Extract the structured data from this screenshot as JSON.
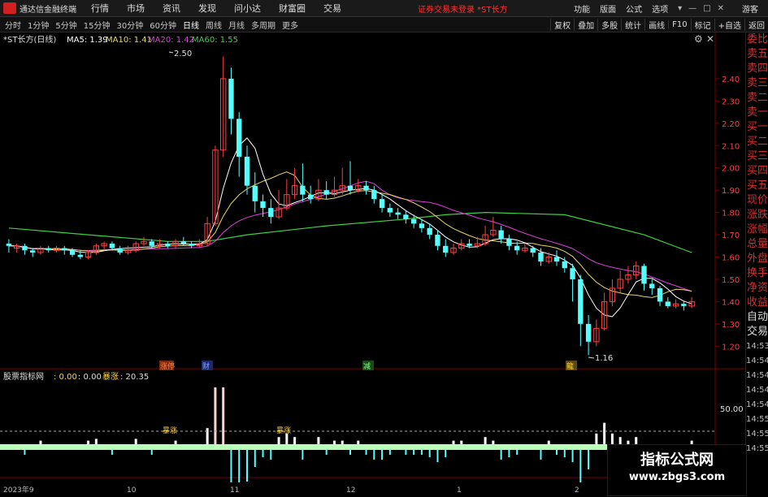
{
  "app": {
    "title": "通达信金融终端"
  },
  "menu": [
    "行情",
    "市场",
    "资讯",
    "发现",
    "问小达",
    "财富圈",
    "交易"
  ],
  "status": "证券交易未登录 *ST长方",
  "top_right": [
    "功能",
    "版面",
    "公式",
    "选项"
  ],
  "guest": "游客",
  "window_controls": [
    "▾",
    "—",
    "□",
    "✕"
  ],
  "periods": [
    "分时",
    "1分钟",
    "5分钟",
    "15分钟",
    "30分钟",
    "60分钟",
    "日线",
    "周线",
    "月线",
    "多周期",
    "更多"
  ],
  "active_period": "日线",
  "toolbar_right": [
    "复权",
    "叠加",
    "多股",
    "统计",
    "画线",
    "F10",
    "标记",
    "+自选",
    "返回"
  ],
  "legend": {
    "stock": "*ST长方(日线)",
    "ma5": "MA5: 1.39",
    "ma10": "MA10: 1.41",
    "ma20": "MA20: 1.42",
    "ma60": "MA60: 1.55"
  },
  "price_axis": [
    "2.40",
    "2.30",
    "2.20",
    "2.10",
    "2.00",
    "1.90",
    "1.80",
    "1.70",
    "1.60",
    "1.50",
    "1.40",
    "1.30",
    "1.20"
  ],
  "annotations": {
    "high": "2.50",
    "low": "1.16"
  },
  "events": [
    "涨停",
    "财",
    "减",
    "龍"
  ],
  "indicator": {
    "name": "股票指标网",
    "v1": ": 0.00",
    "v2": ": 0.00",
    "label": "暴涨",
    "value": ": 20.35",
    "level": "50.00",
    "mark1": "暴涨",
    "mark2": "暴涨"
  },
  "dates": [
    "2023年9",
    "10",
    "11",
    "12",
    "1",
    "2"
  ],
  "side_panel": [
    "委比",
    "卖五",
    "卖四",
    "卖三",
    "卖二",
    "卖一",
    "买一",
    "买二",
    "买三",
    "买四",
    "买五",
    "现价",
    "涨跌",
    "涨幅",
    "总量",
    "外盘",
    "换手",
    "净资",
    "收益",
    "自动",
    "交易"
  ],
  "side_times": [
    "14:53",
    "14:54",
    "14:54",
    "14:54",
    "14:54",
    "14:55",
    "14:55",
    "14:55",
    "14:56"
  ],
  "watermark": {
    "title": "指标公式网",
    "url": "www.zbgs3.com"
  },
  "colors": {
    "up": "#ff4040",
    "down": "#54ffff",
    "ma5": "#ffffff",
    "ma10": "#e8d860",
    "ma20": "#e040e0",
    "ma60": "#40d040",
    "bar_base": "#b8ffb8"
  },
  "chart_data": {
    "type": "candlestick",
    "ylim": [
      1.15,
      2.52
    ],
    "ohlc": [
      [
        1.66,
        1.65,
        1.68,
        1.62
      ],
      [
        1.64,
        1.65,
        1.66,
        1.62
      ],
      [
        1.65,
        1.63,
        1.66,
        1.61
      ],
      [
        1.63,
        1.62,
        1.64,
        1.6
      ],
      [
        1.62,
        1.64,
        1.65,
        1.61
      ],
      [
        1.64,
        1.63,
        1.65,
        1.62
      ],
      [
        1.63,
        1.64,
        1.65,
        1.62
      ],
      [
        1.64,
        1.63,
        1.65,
        1.61
      ],
      [
        1.63,
        1.61,
        1.64,
        1.6
      ],
      [
        1.61,
        1.6,
        1.63,
        1.59
      ],
      [
        1.6,
        1.62,
        1.63,
        1.59
      ],
      [
        1.62,
        1.65,
        1.66,
        1.61
      ],
      [
        1.65,
        1.66,
        1.67,
        1.63
      ],
      [
        1.66,
        1.64,
        1.67,
        1.63
      ],
      [
        1.64,
        1.62,
        1.65,
        1.61
      ],
      [
        1.62,
        1.63,
        1.65,
        1.61
      ],
      [
        1.63,
        1.66,
        1.67,
        1.62
      ],
      [
        1.66,
        1.67,
        1.69,
        1.65
      ],
      [
        1.67,
        1.65,
        1.68,
        1.64
      ],
      [
        1.65,
        1.66,
        1.68,
        1.64
      ],
      [
        1.66,
        1.65,
        1.67,
        1.64
      ],
      [
        1.65,
        1.67,
        1.68,
        1.64
      ],
      [
        1.67,
        1.66,
        1.69,
        1.65
      ],
      [
        1.66,
        1.65,
        1.67,
        1.64
      ],
      [
        1.65,
        1.66,
        1.68,
        1.64
      ],
      [
        1.66,
        1.75,
        1.78,
        1.65
      ],
      [
        1.75,
        2.08,
        2.1,
        1.74
      ],
      [
        2.08,
        2.4,
        2.5,
        2.05
      ],
      [
        2.4,
        2.22,
        2.45,
        2.15
      ],
      [
        2.22,
        2.05,
        2.25,
        1.96
      ],
      [
        2.05,
        1.92,
        2.1,
        1.88
      ],
      [
        1.92,
        1.85,
        1.98,
        1.8
      ],
      [
        1.85,
        1.82,
        1.88,
        1.78
      ],
      [
        1.82,
        1.78,
        1.86,
        1.75
      ],
      [
        1.78,
        1.82,
        1.9,
        1.77
      ],
      [
        1.82,
        1.88,
        1.95,
        1.81
      ],
      [
        1.88,
        1.92,
        2.0,
        1.86
      ],
      [
        1.92,
        1.88,
        2.02,
        1.85
      ],
      [
        1.88,
        1.86,
        1.92,
        1.84
      ],
      [
        1.86,
        1.9,
        1.95,
        1.85
      ],
      [
        1.9,
        1.88,
        1.94,
        1.86
      ],
      [
        1.88,
        1.9,
        1.96,
        1.87
      ],
      [
        1.9,
        1.92,
        2.0,
        1.88
      ],
      [
        1.92,
        1.9,
        2.03,
        1.88
      ],
      [
        1.9,
        1.92,
        1.95,
        1.89
      ],
      [
        1.92,
        1.9,
        1.94,
        1.88
      ],
      [
        1.9,
        1.86,
        1.92,
        1.84
      ],
      [
        1.86,
        1.82,
        1.88,
        1.8
      ],
      [
        1.82,
        1.8,
        1.84,
        1.78
      ],
      [
        1.8,
        1.79,
        1.82,
        1.77
      ],
      [
        1.79,
        1.77,
        1.81,
        1.75
      ],
      [
        1.77,
        1.75,
        1.79,
        1.73
      ],
      [
        1.75,
        1.73,
        1.77,
        1.71
      ],
      [
        1.73,
        1.7,
        1.75,
        1.68
      ],
      [
        1.7,
        1.65,
        1.72,
        1.63
      ],
      [
        1.65,
        1.62,
        1.68,
        1.6
      ],
      [
        1.62,
        1.64,
        1.66,
        1.61
      ],
      [
        1.64,
        1.66,
        1.68,
        1.63
      ],
      [
        1.66,
        1.65,
        1.68,
        1.64
      ],
      [
        1.65,
        1.66,
        1.69,
        1.64
      ],
      [
        1.66,
        1.7,
        1.74,
        1.65
      ],
      [
        1.7,
        1.72,
        1.78,
        1.69
      ],
      [
        1.72,
        1.68,
        1.74,
        1.66
      ],
      [
        1.68,
        1.65,
        1.7,
        1.63
      ],
      [
        1.65,
        1.63,
        1.67,
        1.61
      ],
      [
        1.63,
        1.64,
        1.66,
        1.62
      ],
      [
        1.64,
        1.62,
        1.65,
        1.6
      ],
      [
        1.62,
        1.58,
        1.64,
        1.56
      ],
      [
        1.58,
        1.6,
        1.62,
        1.57
      ],
      [
        1.6,
        1.58,
        1.63,
        1.56
      ],
      [
        1.58,
        1.55,
        1.6,
        1.53
      ],
      [
        1.55,
        1.5,
        1.57,
        1.4
      ],
      [
        1.5,
        1.3,
        1.52,
        1.2
      ],
      [
        1.3,
        1.22,
        1.34,
        1.16
      ],
      [
        1.22,
        1.28,
        1.32,
        1.2
      ],
      [
        1.28,
        1.4,
        1.44,
        1.27
      ],
      [
        1.4,
        1.46,
        1.5,
        1.38
      ],
      [
        1.46,
        1.5,
        1.54,
        1.44
      ],
      [
        1.5,
        1.52,
        1.56,
        1.48
      ],
      [
        1.52,
        1.56,
        1.58,
        1.5
      ],
      [
        1.56,
        1.48,
        1.57,
        1.45
      ],
      [
        1.48,
        1.46,
        1.5,
        1.43
      ],
      [
        1.46,
        1.4,
        1.47,
        1.38
      ],
      [
        1.4,
        1.38,
        1.42,
        1.37
      ],
      [
        1.38,
        1.39,
        1.41,
        1.37
      ],
      [
        1.39,
        1.38,
        1.4,
        1.36
      ],
      [
        1.38,
        1.4,
        1.42,
        1.37
      ]
    ],
    "ma60": [
      [
        0,
        1.73
      ],
      [
        10,
        1.7
      ],
      [
        20,
        1.67
      ],
      [
        25,
        1.67
      ],
      [
        30,
        1.7
      ],
      [
        40,
        1.74
      ],
      [
        50,
        1.77
      ],
      [
        55,
        1.79
      ],
      [
        60,
        1.8
      ],
      [
        70,
        1.79
      ],
      [
        80,
        1.7
      ],
      [
        86,
        1.62
      ]
    ]
  }
}
